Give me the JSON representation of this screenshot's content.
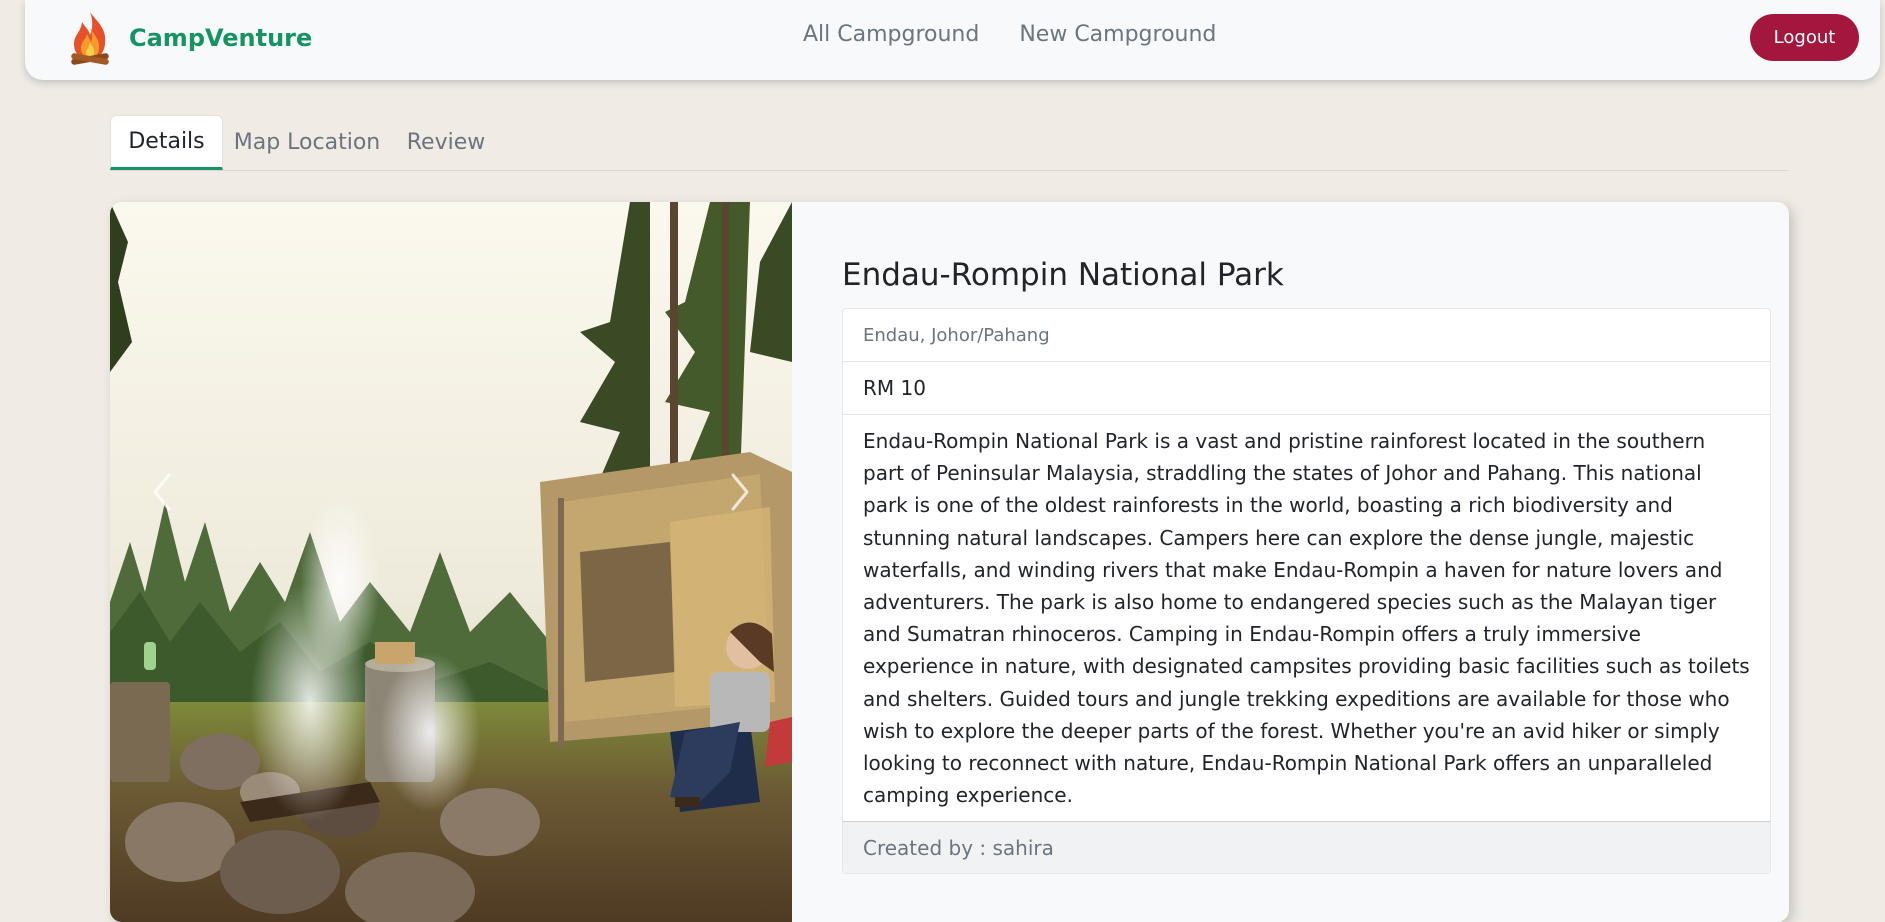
{
  "navbar": {
    "brand": "CampVenture",
    "links": [
      "All Campground",
      "New Campground"
    ],
    "logout_label": "Logout"
  },
  "tabs": [
    {
      "label": "Details",
      "active": true
    },
    {
      "label": "Map Location",
      "active": false
    },
    {
      "label": "Review",
      "active": false
    }
  ],
  "campground": {
    "title": "Endau-Rompin National Park",
    "location": "Endau, Johor/Pahang",
    "price": "RM 10",
    "description": "Endau-Rompin National Park is a vast and pristine rainforest located in the southern part of Peninsular Malaysia, straddling the states of Johor and Pahang. This national park is one of the oldest rainforests in the world, boasting a rich biodiversity and stunning natural landscapes. Campers here can explore the dense jungle, majestic waterfalls, and winding rivers that make Endau-Rompin a haven for nature lovers and adventurers. The park is also home to endangered species such as the Malayan tiger and Sumatran rhinoceros. Camping in Endau-Rompin offers a truly immersive experience in nature, with designated campsites providing basic facilities such as toilets and shelters. Guided tours and jungle trekking expeditions are available for those who wish to explore the deeper parts of the forest. Whether you're an avid hiker or simply looking to reconnect with nature, Endau-Rompin National Park offers an unparalleled camping experience.",
    "created_by": "Created by : sahira"
  },
  "carousel": {
    "prev_icon": "chevron-left-icon",
    "next_icon": "chevron-right-icon"
  },
  "colors": {
    "brand": "#149463",
    "logout": "#a4173d",
    "page_background": "#f0ebe5"
  }
}
